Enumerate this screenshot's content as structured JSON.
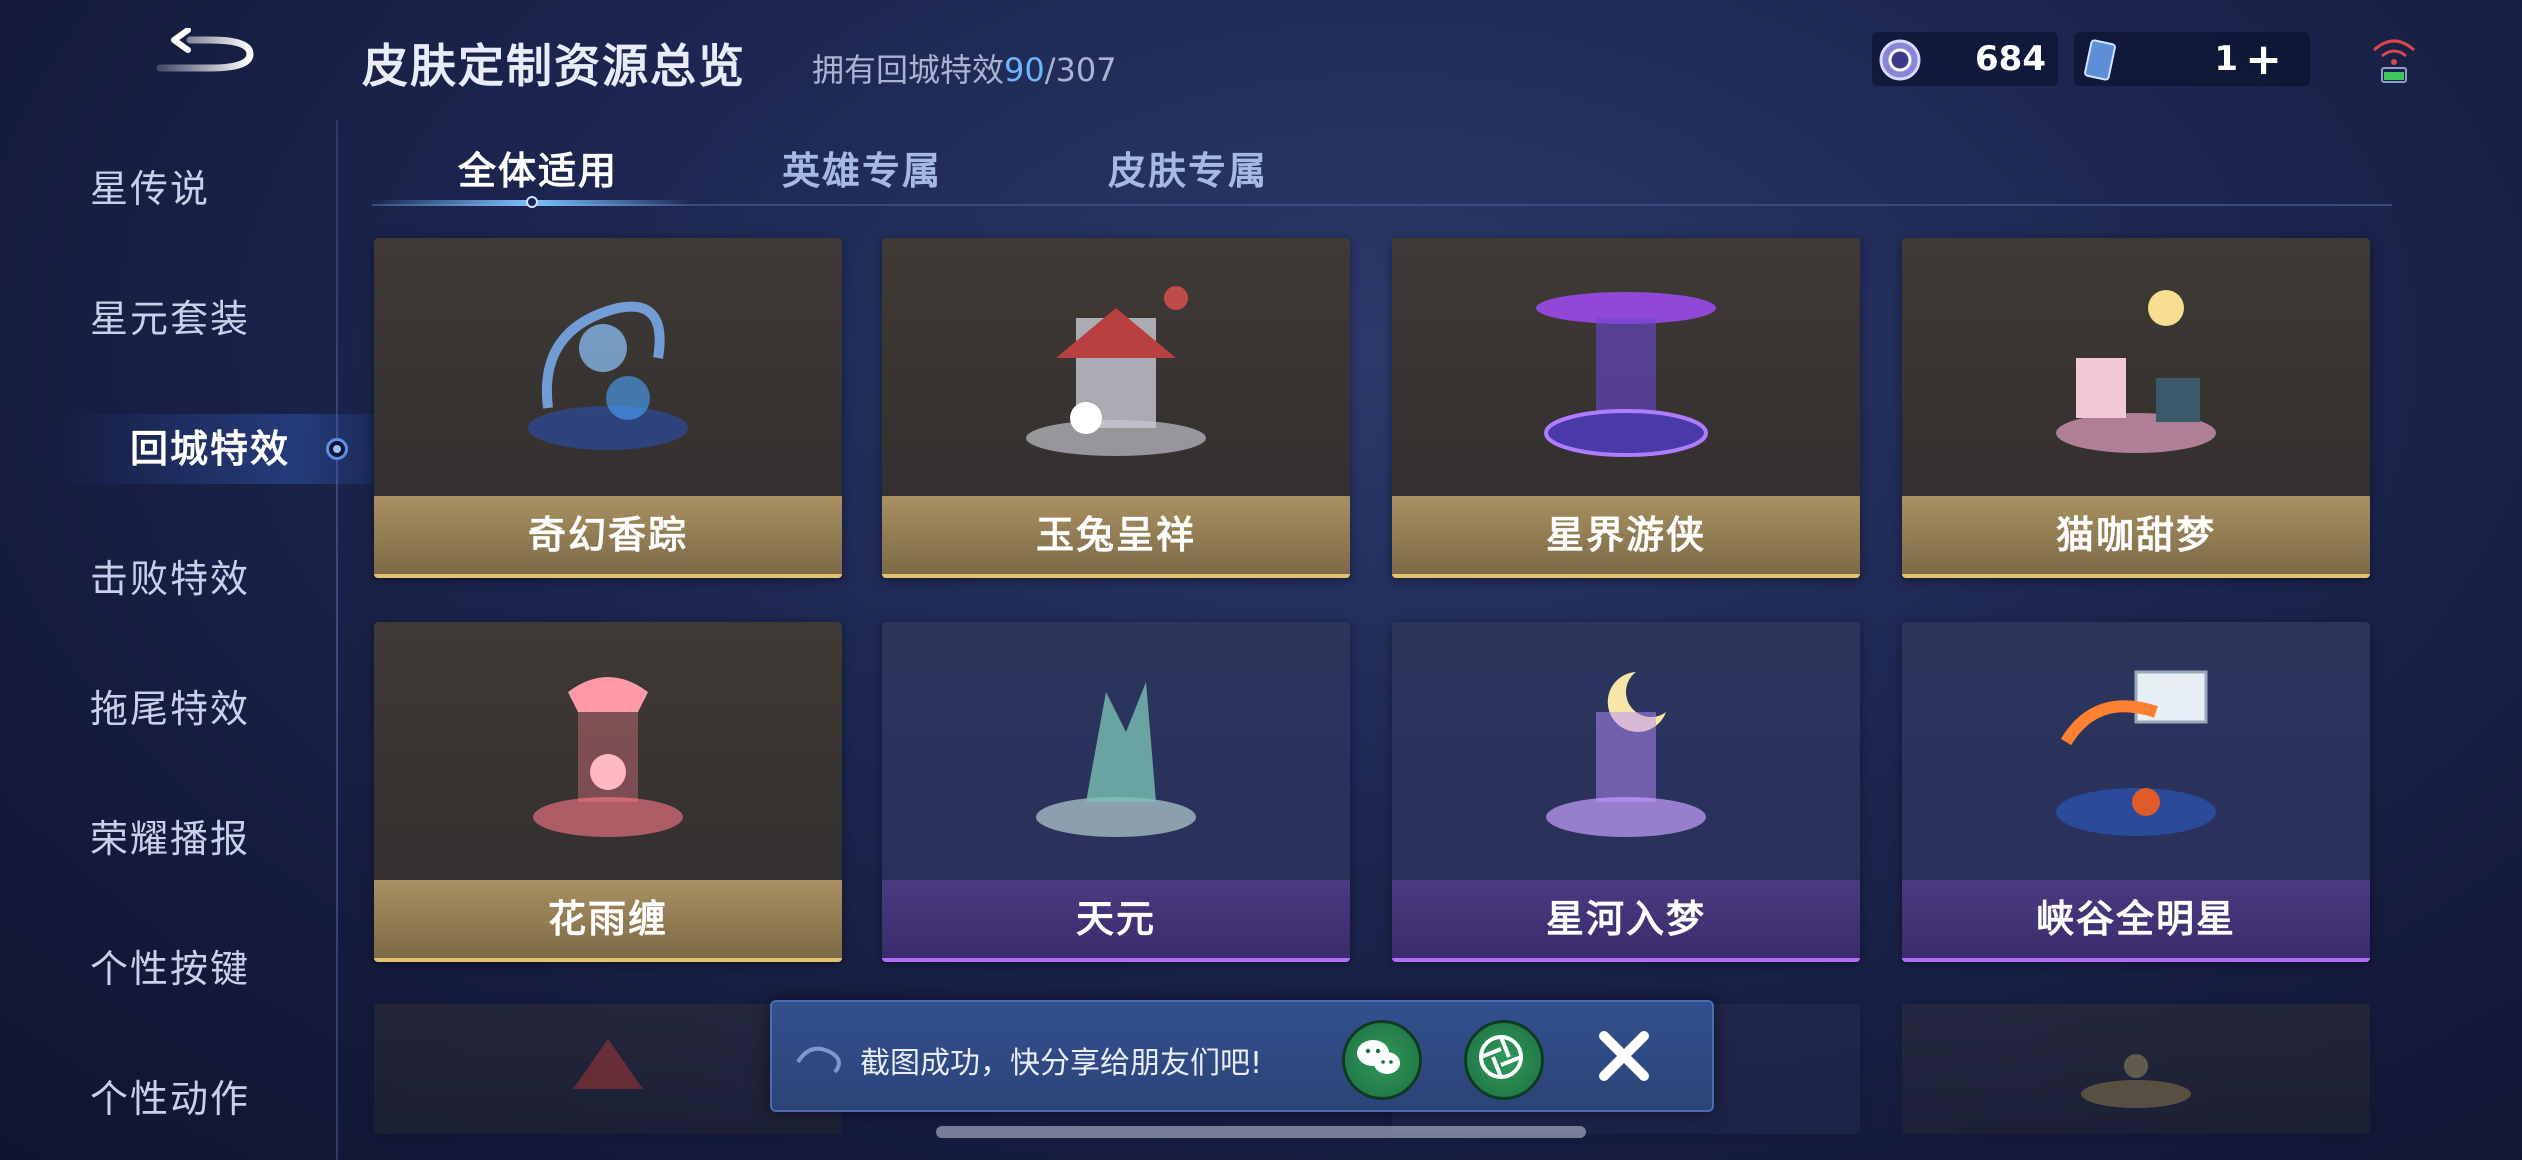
{
  "header": {
    "title": "皮肤定制资源总览",
    "owned_prefix": "拥有回城特效",
    "owned_count": "90",
    "owned_total": "/307"
  },
  "currency": {
    "gems": "684",
    "coupons": "1",
    "plus": "+"
  },
  "sidebar": {
    "items": [
      {
        "label": "星传说"
      },
      {
        "label": "星元套装"
      },
      {
        "label": "回城特效",
        "active": true
      },
      {
        "label": "击败特效"
      },
      {
        "label": "拖尾特效"
      },
      {
        "label": "荣耀播报"
      },
      {
        "label": "个性按键"
      },
      {
        "label": "个性动作"
      }
    ]
  },
  "tabs": [
    {
      "label": "全体适用",
      "active": true
    },
    {
      "label": "英雄专属"
    },
    {
      "label": "皮肤专属"
    }
  ],
  "cards": [
    {
      "name": "奇幻香踪",
      "tier": "gold",
      "icon": "fantasy-fragrance-icon"
    },
    {
      "name": "玉兔呈祥",
      "tier": "gold",
      "icon": "jade-rabbit-icon"
    },
    {
      "name": "星界游侠",
      "tier": "gold",
      "icon": "astral-ranger-icon"
    },
    {
      "name": "猫咖甜梦",
      "tier": "gold",
      "icon": "cat-cafe-icon"
    },
    {
      "name": "花雨缠",
      "tier": "gold",
      "icon": "flower-rain-icon"
    },
    {
      "name": "天元",
      "tier": "purple",
      "icon": "tianyuan-icon"
    },
    {
      "name": "星河入梦",
      "tier": "purple",
      "icon": "galaxy-dream-icon"
    },
    {
      "name": "峡谷全明星",
      "tier": "purple",
      "icon": "canyon-allstar-icon"
    }
  ],
  "toast": {
    "message": "截图成功，快分享给朋友们吧!"
  },
  "colors": {
    "gold_accent": "#e5c270",
    "purple_accent": "#b06cff",
    "tab_active": "#7cc2ff",
    "highlight_number": "#6fb4ff"
  }
}
